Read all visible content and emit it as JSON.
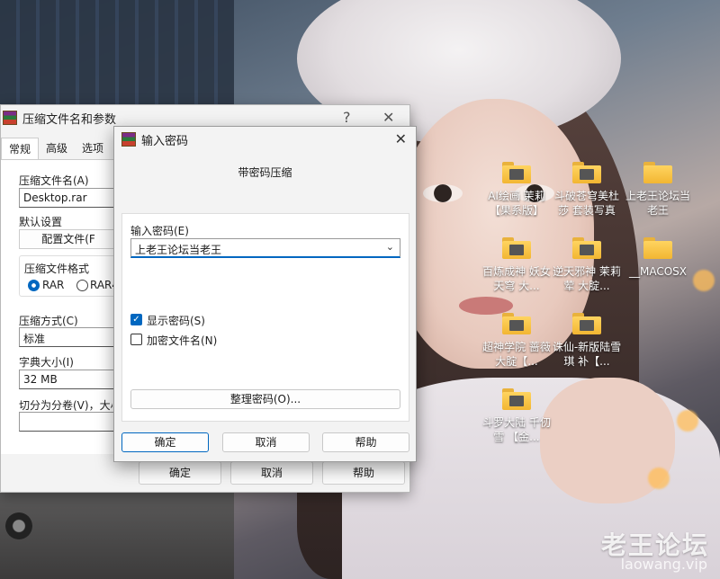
{
  "desktop": {
    "icons": [
      {
        "label": "AI绘画 茉莉【果系版】"
      },
      {
        "label": "斗破苍穹美杜莎 套装写真"
      },
      {
        "label": "上老王论坛当老王"
      },
      {
        "label": "百炼成神 妖女天穹 大..."
      },
      {
        "label": "逆天邪神 茉莉 荤 大腚..."
      },
      {
        "label": "__MACOSX"
      },
      {
        "label": "超神学院 蔷薇 大腚【..."
      },
      {
        "label": "诛仙-新版陆雪琪 补【..."
      },
      {
        "label": "斗罗大陆 千仞雪 【金..."
      }
    ],
    "watermark": {
      "cn": "老王论坛",
      "en": "laowang.vip"
    }
  },
  "compress_window": {
    "title": "压缩文件名和参数",
    "help_glyph": "?",
    "close_glyph": "✕",
    "tabs": [
      "常规",
      "高级",
      "选项"
    ],
    "archive_name_label": "压缩文件名(A)",
    "archive_name_value": "Desktop.rar",
    "default_settings_label": "默认设置",
    "profiles_button": "配置文件(F",
    "format_label": "压缩文件格式",
    "format_rar": "RAR",
    "format_rar4": "RAR4",
    "method_label": "压缩方式(C)",
    "method_value": "标准",
    "dict_label": "字典大小(I)",
    "dict_value": "32 MB",
    "split_label": "切分为分卷(V)，大小",
    "ok": "确定",
    "cancel": "取消",
    "help": "帮助"
  },
  "password_dialog": {
    "title": "输入密码",
    "close_glyph": "✕",
    "subtitle": "带密码压缩",
    "password_label": "输入密码(E)",
    "password_value": "上老王论坛当老王",
    "show_password": "显示密码(S)",
    "show_password_checked": true,
    "encrypt_names": "加密文件名(N)",
    "encrypt_names_checked": false,
    "organize_button": "整理密码(O)...",
    "ok": "确定",
    "cancel": "取消",
    "help": "帮助"
  }
}
